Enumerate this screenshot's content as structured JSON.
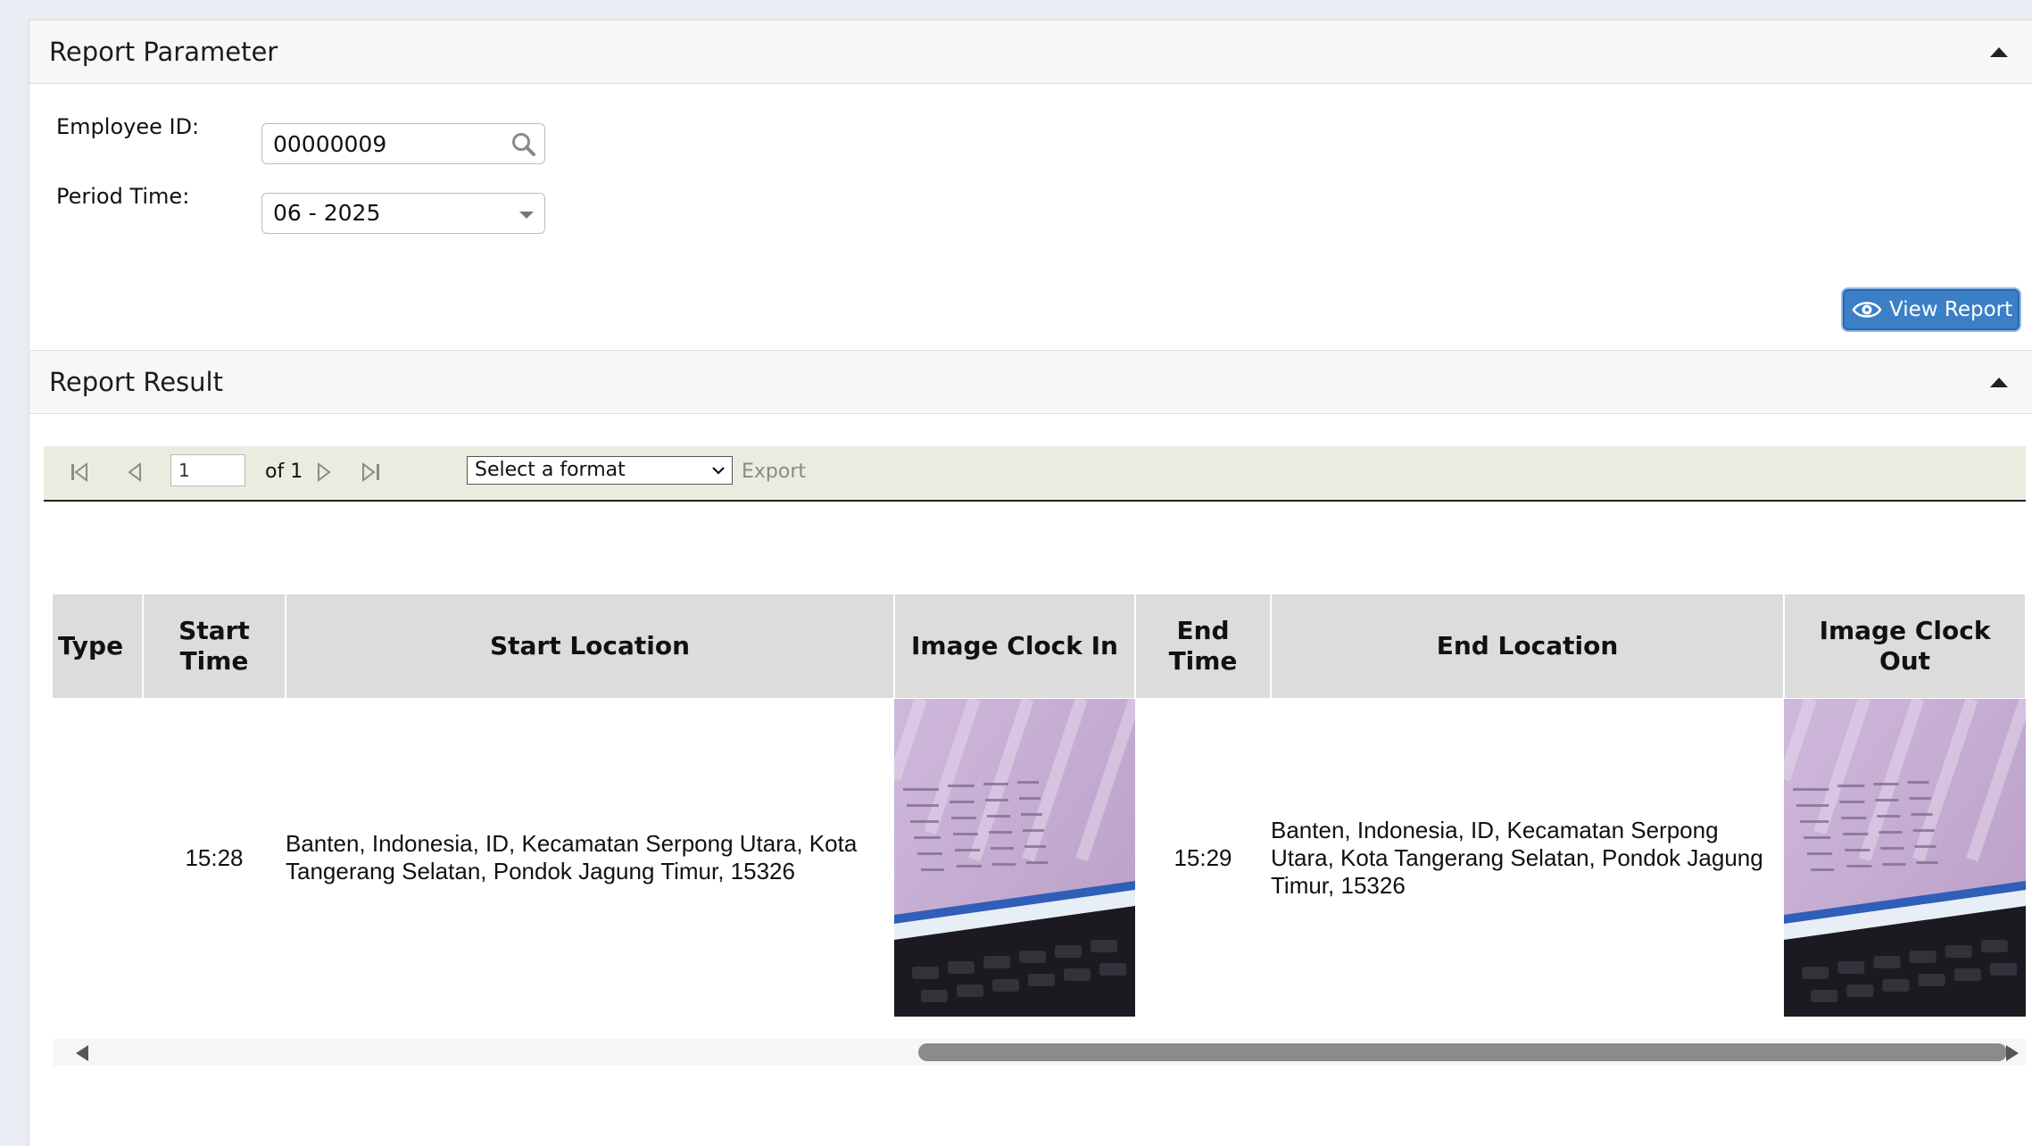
{
  "report_parameter": {
    "title": "Report Parameter",
    "employee_id_label": "Employee ID:",
    "employee_id_value": "00000009",
    "period_time_label": "Period Time:",
    "period_time_value": "06 - 2025",
    "view_report_label": "View Report"
  },
  "report_result": {
    "title": "Report Result",
    "toolbar": {
      "page_value": "1",
      "of_label": "of 1",
      "format_selected": "Select a format",
      "export_label": "Export"
    },
    "table": {
      "headers": {
        "type": "Type",
        "start_time": "Start Time",
        "start_location": "Start Location",
        "image_clock_in": "Image Clock In",
        "end_time": "End Time",
        "end_location": "End Location",
        "image_clock_out": "Image Clock Out"
      },
      "rows": [
        {
          "type": "",
          "start_time": "15:28",
          "start_location": "Banten, Indonesia, ID, Kecamatan Serpong Utara, Kota Tangerang Selatan, Pondok Jagung Timur, 15326",
          "end_time": "15:29",
          "end_location": "Banten, Indonesia, ID, Kecamatan Serpong Utara, Kota Tangerang Selatan, Pondok Jagung Timur, 15326"
        }
      ]
    }
  },
  "colors": {
    "accent_button": "#3b7fc7",
    "toolbar_bg": "#ecebdf",
    "header_bg": "#dcdcdc"
  }
}
